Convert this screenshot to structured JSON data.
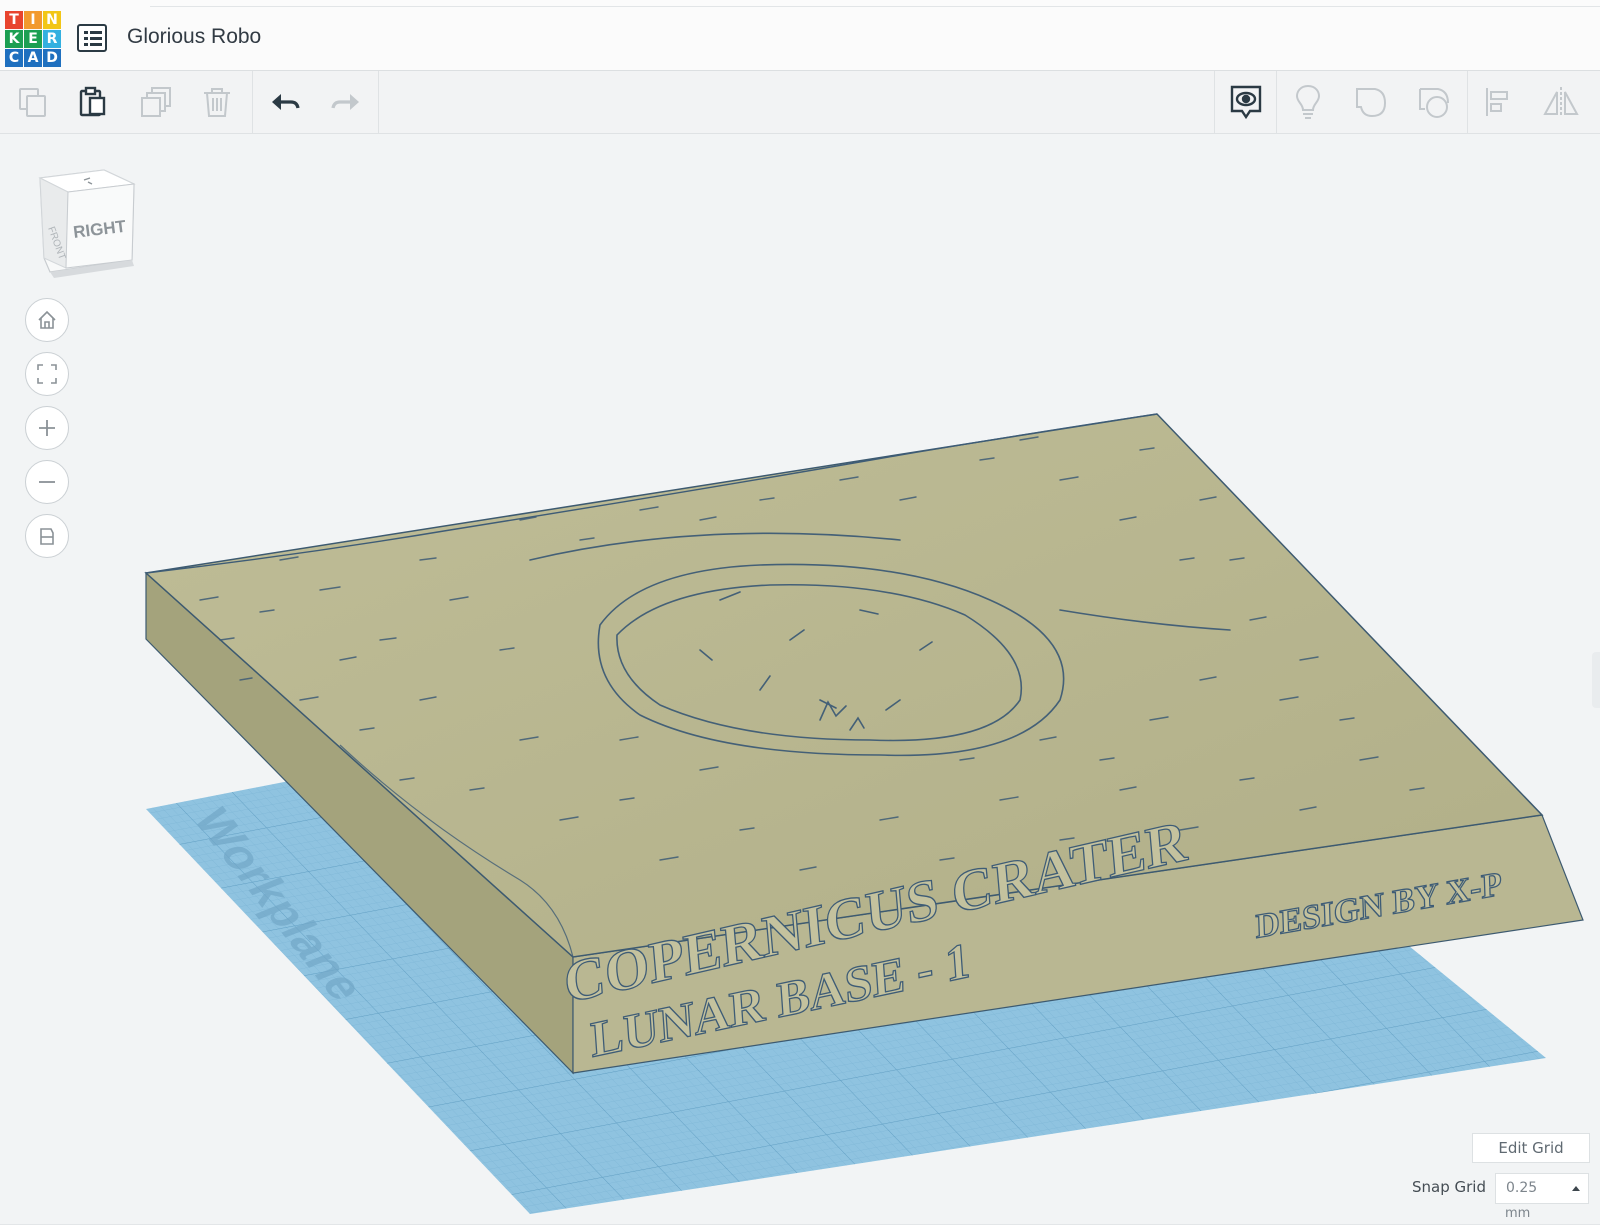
{
  "app": {
    "logo_letters": [
      "T",
      "I",
      "N",
      "K",
      "E",
      "R",
      "C",
      "A",
      "D"
    ],
    "logo_colors": [
      "#e8442e",
      "#f29a2e",
      "#f2c617",
      "#1c9f52",
      "#1c9f52",
      "#33b0e0",
      "#1f70bf",
      "#1f70bf",
      "#1f70bf"
    ],
    "title": "Glorious Robo"
  },
  "toolbar": {
    "left": [
      {
        "name": "copy-icon",
        "enabled": false
      },
      {
        "name": "paste-icon",
        "enabled": true
      },
      {
        "name": "duplicate-icon",
        "enabled": false
      },
      {
        "name": "delete-icon",
        "enabled": false
      },
      {
        "name": "undo-icon",
        "enabled": true
      },
      {
        "name": "redo-icon",
        "enabled": false
      }
    ],
    "right": [
      {
        "name": "notes-eye-icon",
        "enabled": true
      },
      {
        "name": "lightbulb-icon",
        "enabled": false
      },
      {
        "name": "solid-shape-icon",
        "enabled": false
      },
      {
        "name": "hole-shape-icon",
        "enabled": false
      },
      {
        "name": "align-icon",
        "enabled": false
      },
      {
        "name": "mirror-icon",
        "enabled": false
      }
    ]
  },
  "viewcube": {
    "face_label": "RIGHT"
  },
  "nav": [
    "home-icon",
    "fit-view-icon",
    "zoom-in-icon",
    "zoom-out-icon",
    "ortho-view-icon"
  ],
  "scene": {
    "workplane_label": "Workplane",
    "model_text_line1": "COPERNICUS CRATER",
    "model_text_line2": "LUNAR BASE - 1",
    "model_text_credit": "DESIGN BY X-P",
    "model_color": "#b5b38c",
    "grid_color": "#8fc3e0"
  },
  "grid": {
    "edit_label": "Edit Grid",
    "snap_label": "Snap Grid",
    "snap_value": "0.25",
    "snap_unit": "mm"
  }
}
